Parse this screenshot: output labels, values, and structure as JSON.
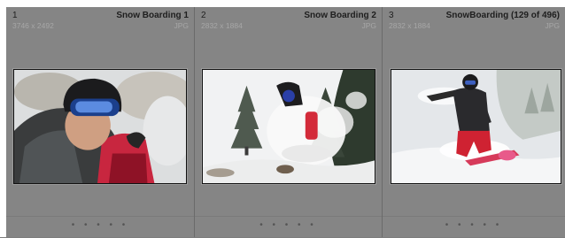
{
  "cells": [
    {
      "index": "1",
      "title": "Snow Boarding 1",
      "dimensions": "3746 x 2492",
      "format": "JPG",
      "rating_dots": "• • • • •"
    },
    {
      "index": "2",
      "title": "Snow Boarding 2",
      "dimensions": "2832 x 1884",
      "format": "JPG",
      "rating_dots": "• • • • •"
    },
    {
      "index": "3",
      "title": "SnowBoarding (129 of 496)",
      "dimensions": "2832 x 1884",
      "format": "JPG",
      "rating_dots": "• • • • •"
    }
  ],
  "colors": {
    "grid_background": "#858585",
    "cell_border": "#6a6a6a",
    "header_text": "#1e1e1e",
    "meta_text": "#a7a7a7"
  }
}
